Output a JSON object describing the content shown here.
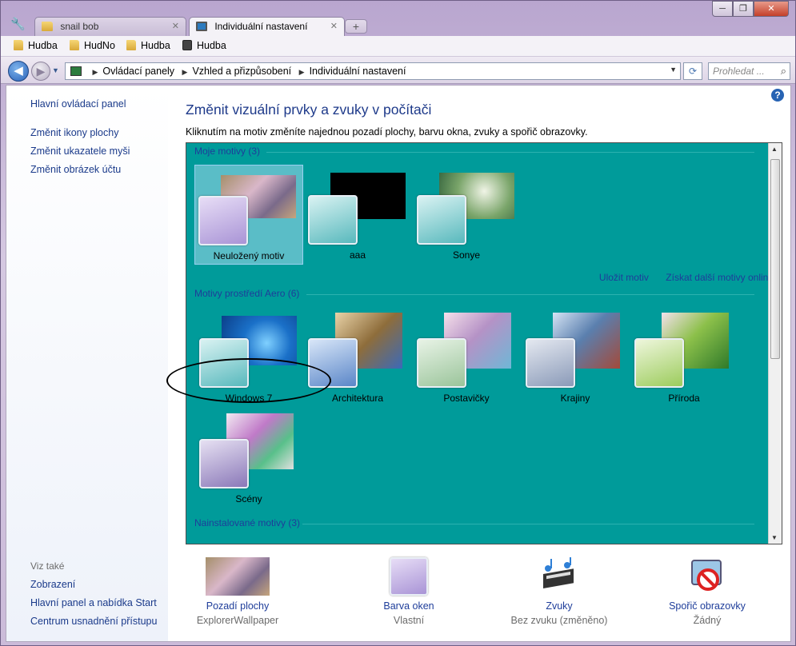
{
  "tabs": [
    {
      "label": "snail bob",
      "active": false
    },
    {
      "label": "Individuální nastavení",
      "active": true
    }
  ],
  "window_controls": {
    "minimize": "─",
    "maximize": "❐",
    "close": "✕"
  },
  "bookmarks": [
    "Hudba",
    "HudNo",
    "Hudba",
    "Hudba"
  ],
  "address": {
    "breadcrumbs": [
      "Ovládací panely",
      "Vzhled a přizpůsobení",
      "Individuální nastavení"
    ],
    "search_placeholder": "Prohledat ..."
  },
  "sidebar": {
    "home_link": "Hlavní ovládací panel",
    "links": [
      "Změnit ikony plochy",
      "Změnit ukazatele myši",
      "Změnit obrázek účtu"
    ],
    "see_also_head": "Viz také",
    "see_also": [
      "Zobrazení",
      "Hlavní panel a nabídka Start",
      "Centrum usnadnění přístupu"
    ]
  },
  "main": {
    "title": "Změnit vizuální prvky a zvuky v počítači",
    "subtitle": "Kliknutím na motiv změníte najednou pozadí plochy, barvu okna, zvuky a spořič obrazovky."
  },
  "themes": {
    "my_group": "Moje motivy (3)",
    "my_themes": [
      "Neuložený motiv",
      "aaa",
      "Sonye"
    ],
    "save_link": "Uložit motiv",
    "more_link": "Získat další motivy online",
    "aero_group": "Motivy prostředí Aero (6)",
    "aero_themes": [
      "Windows 7",
      "Architektura",
      "Postavičky",
      "Krajiny",
      "Příroda",
      "Scény"
    ],
    "installed_group": "Nainstalované motivy (3)"
  },
  "bottom": [
    {
      "label": "Pozadí plochy",
      "value": "ExplorerWallpaper"
    },
    {
      "label": "Barva oken",
      "value": "Vlastní"
    },
    {
      "label": "Zvuky",
      "value": "Bez zvuku (změněno)"
    },
    {
      "label": "Spořič obrazovky",
      "value": "Žádný"
    }
  ],
  "colors": {
    "theme_area_bg": "#009b9a",
    "link_blue": "#1e3d9a",
    "window_tint": "#b9a6cf"
  },
  "icons": [
    "wrench-icon",
    "folder-icon",
    "monitor-icon",
    "speaker-icon",
    "back-arrow-icon",
    "forward-arrow-icon",
    "refresh-icon",
    "search-icon",
    "help-icon",
    "music-notes-icon",
    "no-screensaver-icon"
  ]
}
